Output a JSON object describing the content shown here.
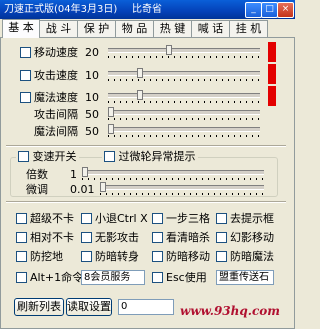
{
  "window": {
    "title": "刀速正式版(04年3月3日)",
    "subtitle": "比奇省",
    "buttons": [
      "_",
      "□",
      "×"
    ]
  },
  "tabs": [
    "基 本",
    "战 斗",
    "保 护",
    "物 品",
    "热 键",
    "喊 话",
    "挂 机"
  ],
  "speed_sliders": [
    {
      "label": "移动速度",
      "value": "20",
      "checkbox": true,
      "level": 0.4
    },
    {
      "label": "攻击速度",
      "value": "10",
      "checkbox": true,
      "level": 0.2
    },
    {
      "label": "魔法速度",
      "value": "10",
      "checkbox": true,
      "level": 0.2
    },
    {
      "label": "攻击间隔",
      "value": "50",
      "checkbox": false,
      "level": 0.0
    },
    {
      "label": "魔法间隔",
      "value": "50",
      "checkbox": false,
      "level": 0.0
    }
  ],
  "gear": {
    "toggle_label": "变速开关",
    "bypass_label": "过微轮异常提示",
    "multiplier_label": "倍数",
    "multiplier_value": "1",
    "fine_label": "微调",
    "fine_value": "0.01"
  },
  "options": [
    [
      "超级不卡",
      "小退Ctrl X",
      "一步三格",
      "去提示框"
    ],
    [
      "相对不卡",
      "无影攻击",
      "看清暗杀",
      "幻影移动"
    ],
    [
      "防挖地",
      "防暗转身",
      "防暗移动",
      "防暗魔法"
    ]
  ],
  "bottom_row": {
    "alt_label": "Alt+1命令",
    "member_service": "8会员服务",
    "esc_label": "Esc使用",
    "hotkey_field": "盟重传送石"
  },
  "actions": {
    "refresh_label": "刷新列表",
    "read_label": "读取设置",
    "input_value": "0"
  },
  "watermark": "www.93hq.com",
  "colors": {
    "titlebar": "#0441b8",
    "window_bg": "#ece9d8",
    "red_marker": "#e30000"
  }
}
